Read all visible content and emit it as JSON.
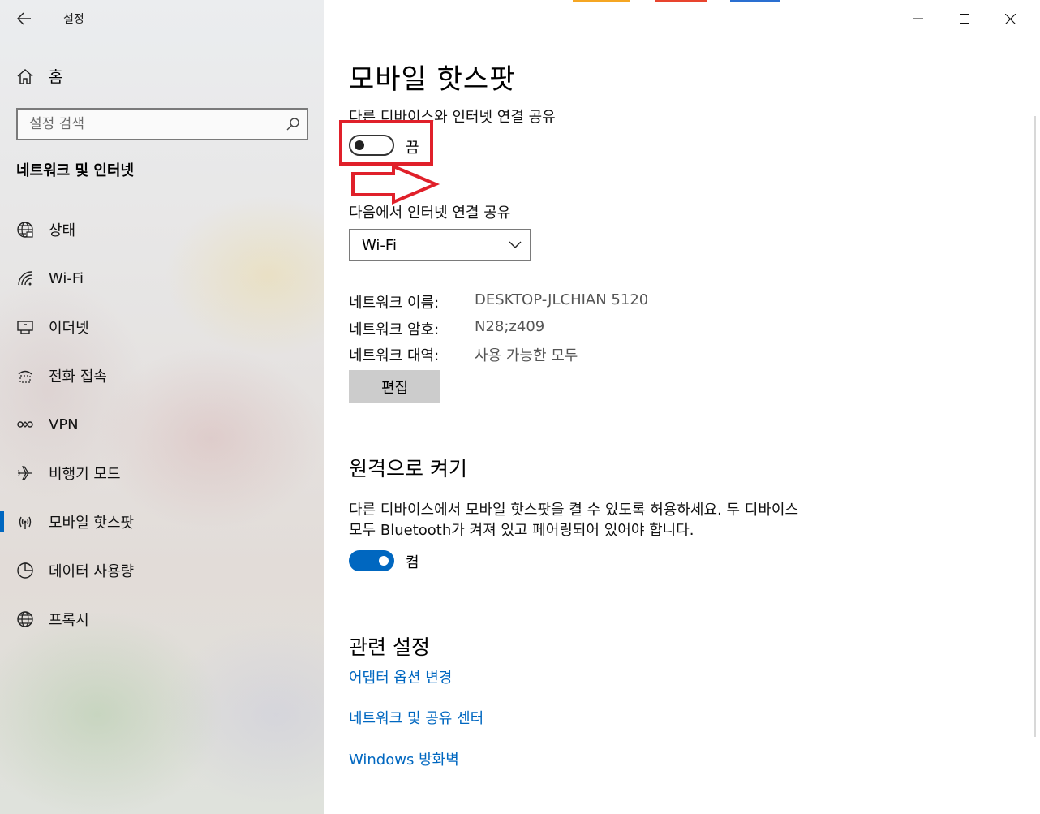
{
  "window": {
    "title": "설정"
  },
  "sidebar": {
    "home_label": "홈",
    "search_placeholder": "설정 검색",
    "section_title": "네트워크 및 인터넷",
    "items": [
      {
        "label": "상태",
        "icon": "globe-status-icon"
      },
      {
        "label": "Wi-Fi",
        "icon": "wifi-icon"
      },
      {
        "label": "이더넷",
        "icon": "ethernet-icon"
      },
      {
        "label": "전화 접속",
        "icon": "dialup-icon"
      },
      {
        "label": "VPN",
        "icon": "vpn-icon"
      },
      {
        "label": "비행기 모드",
        "icon": "airplane-icon"
      },
      {
        "label": "모바일 핫스팟",
        "icon": "hotspot-icon",
        "active": true
      },
      {
        "label": "데이터 사용량",
        "icon": "data-usage-icon"
      },
      {
        "label": "프록시",
        "icon": "proxy-globe-icon"
      }
    ]
  },
  "main": {
    "title": "모바일 핫스팟",
    "share_label": "다른 디바이스와 인터넷 연결 공유",
    "share_toggle": {
      "state": "off",
      "label": "끔"
    },
    "share_from_label": "다음에서 인터넷 연결 공유",
    "share_from_value": "Wi-Fi",
    "network_name_label": "네트워크 이름:",
    "network_name_value": "DESKTOP-JLCHIAN 5120",
    "network_password_label": "네트워크 암호:",
    "network_password_value": "N28;z409",
    "network_band_label": "네트워크 대역:",
    "network_band_value": "사용 가능한 모두",
    "edit_label": "편집",
    "remote_title": "원격으로 켜기",
    "remote_desc": "다른 디바이스에서 모바일 핫스팟을 켤 수 있도록 허용하세요. 두 디바이스 모두 Bluetooth가 켜져 있고 페어링되어 있어야 합니다.",
    "remote_toggle": {
      "state": "on",
      "label": "켬"
    },
    "related_title": "관련 설정",
    "links": [
      "어댑터 옵션 변경",
      "네트워크 및 공유 센터",
      "Windows 방화벽"
    ]
  },
  "colors": {
    "accent": "#0067c0",
    "annotation": "#e0202a"
  }
}
